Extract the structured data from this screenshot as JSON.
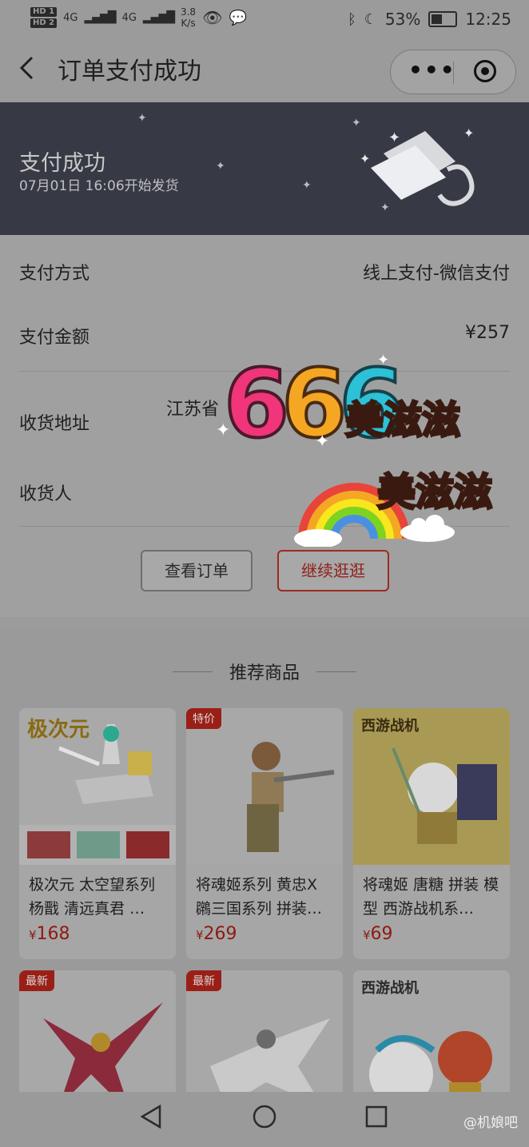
{
  "statusbar": {
    "hd1": "HD 1",
    "hd2": "HD 2",
    "net1": "4G",
    "net2": "4G",
    "speed": "3.8",
    "speed_unit": "K/s",
    "battery": "53%",
    "battery_fraction": 0.53,
    "time": "12:25"
  },
  "nav": {
    "title": "订单支付成功",
    "more": "•••"
  },
  "banner": {
    "title": "支付成功",
    "subtitle": "07月01日 16:06开始发货"
  },
  "info": {
    "pay_method_label": "支付方式",
    "pay_method_value": "线上支付-微信支付",
    "amount_label": "支付金额",
    "amount_value": "¥257",
    "address_label": "收货地址",
    "address_value": "江苏省",
    "receiver_label": "收货人",
    "btn_view_order": "查看订单",
    "btn_continue": "继续逛逛"
  },
  "sticker": {
    "number": "666",
    "text1": "美滋滋",
    "text2": "美滋滋"
  },
  "recommend": {
    "heading": "推荐商品",
    "products": [
      {
        "name": "极次元 太空望系列 杨戬 清远真君 …",
        "currency": "¥",
        "price": "168",
        "tag": "",
        "brand": "极次元"
      },
      {
        "name": "将魂姬系列 黄忠X 鸊三国系列 拼装…",
        "currency": "¥",
        "price": "269",
        "tag": "特价",
        "brand": ""
      },
      {
        "name": "将魂姬 唐糖 拼装 模型 西游战机系…",
        "currency": "¥",
        "price": "69",
        "tag": "",
        "brand": "西游战机"
      },
      {
        "name": "",
        "currency": "",
        "price": "",
        "tag": "最新",
        "brand": ""
      },
      {
        "name": "",
        "currency": "",
        "price": "",
        "tag": "最新",
        "brand": ""
      },
      {
        "name": "",
        "currency": "",
        "price": "",
        "tag": "",
        "brand": "西游战机"
      }
    ]
  },
  "watermark": "@机娘吧",
  "colors": {
    "banner_bg": "#373a45",
    "accent_red": "#9a1f16"
  }
}
